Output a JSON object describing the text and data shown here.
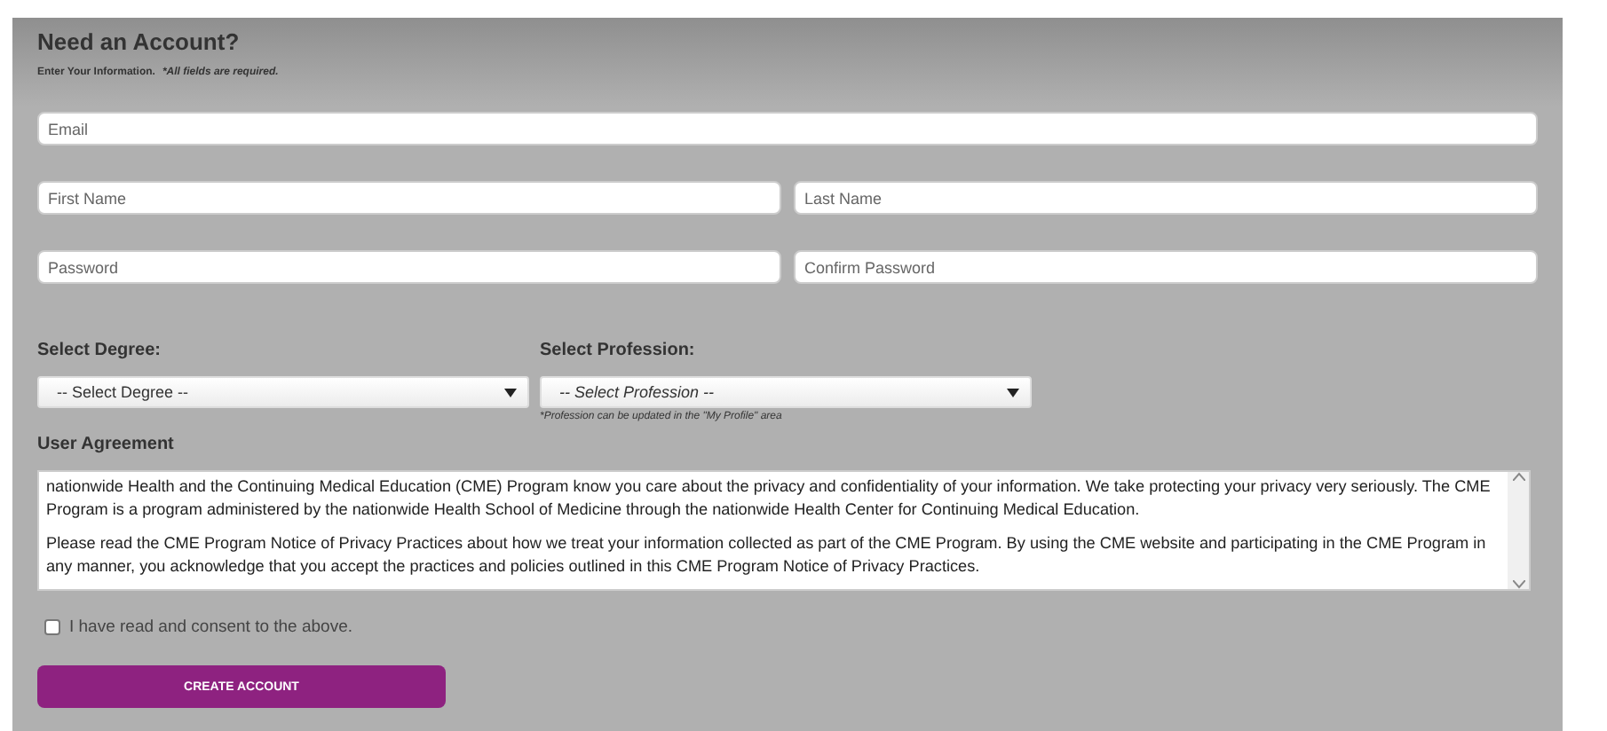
{
  "heading": "Need an Account?",
  "intro": {
    "text": "Enter Your Information.",
    "note": "*All fields are required."
  },
  "fields": [
    {
      "placeholder": "Email"
    },
    {
      "placeholder": "First Name"
    },
    {
      "placeholder": "Last Name"
    },
    {
      "placeholder": "Password"
    },
    {
      "placeholder": "Confirm Password"
    }
  ],
  "selects": [
    {
      "label": "Select Degree:",
      "value": "-- Select Degree --",
      "italic": false
    },
    {
      "label": "Select Profession:",
      "value": "-- Select Profession --",
      "italic": true,
      "note": "*Profession can be updated in the \"My Profile\" area"
    }
  ],
  "agreement": {
    "title": "User Agreement",
    "paragraphs": [
      "nationwide Health and the Continuing Medical Education (CME) Program know you care about the privacy and confidentiality of your information. We take protecting your privacy very seriously. The CME Program is a program administered by the nationwide Health School of Medicine through the nationwide Health Center for Continuing Medical Education.",
      "Please read the CME Program Notice of Privacy Practices about how we treat your information collected as part of the CME Program. By using the CME website and participating in the CME Program in any manner, you acknowledge that you accept the practices and policies outlined in this CME Program Notice of Privacy Practices."
    ]
  },
  "consent": {
    "label": "I have read and consent to the above.",
    "checked": false
  },
  "button": "CREATE ACCOUNT"
}
